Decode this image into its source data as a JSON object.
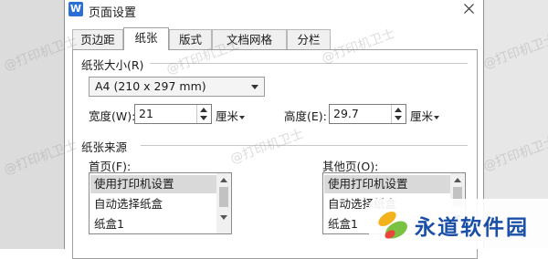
{
  "window": {
    "app_icon": "W",
    "title": "页面设置"
  },
  "tabs": [
    {
      "label": "页边距",
      "active": false
    },
    {
      "label": "纸张",
      "active": true
    },
    {
      "label": "版式",
      "active": false
    },
    {
      "label": "文档网格",
      "active": false
    },
    {
      "label": "分栏",
      "active": false
    }
  ],
  "paper_size": {
    "section_title": "纸张大小(R)",
    "selected": "A4 (210 x 297 mm)",
    "width_label": "宽度(W):",
    "width_value": "21",
    "height_label": "高度(E):",
    "height_value": "29.7",
    "unit": "厘米"
  },
  "paper_source": {
    "section_title": "纸张来源",
    "first_page_label": "首页(F):",
    "other_pages_label": "其他页(O):",
    "first_page_options": [
      "使用打印机设置",
      "自动选择纸盒",
      "纸盒1"
    ],
    "other_pages_options": [
      "使用打印机设置",
      "自动选择纸盒",
      "纸盒1"
    ]
  },
  "watermark_text": "@打印机卫士",
  "logo_text": "永道软件园",
  "colors": {
    "accent": "#2b6fd4",
    "logo_blue": "#1a4fa8",
    "selection": "#d9d9d9"
  }
}
